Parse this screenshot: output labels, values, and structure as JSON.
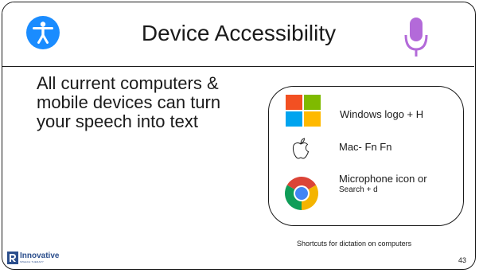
{
  "slide": {
    "title": "Device Accessibility",
    "body_text": "All current computers & mobile devices can turn your speech into text",
    "slide_number": "43"
  },
  "shortcuts": {
    "windows": {
      "icon": "windows-logo-icon",
      "label": "Windows logo + H"
    },
    "mac": {
      "icon": "apple-logo-icon",
      "label": "Mac- Fn Fn"
    },
    "chrome": {
      "icon": "chrome-logo-icon",
      "label": "Microphone icon or",
      "sub_label": "Search + d"
    }
  },
  "caption": "Shortcuts for dictation on computers",
  "logo": {
    "text": "Innovative",
    "subtext": "SPEECH THERAPY"
  },
  "icons": {
    "accessibility": "accessibility-icon",
    "microphone": "microphone-icon"
  },
  "colors": {
    "accessibility_blue": "#1a8cff",
    "microphone_purple": "#b36ad9",
    "windows_red": "#f25022",
    "windows_green": "#7fba00",
    "windows_blue": "#00a4ef",
    "windows_yellow": "#ffb900",
    "logo_blue": "#2b4e8c"
  }
}
